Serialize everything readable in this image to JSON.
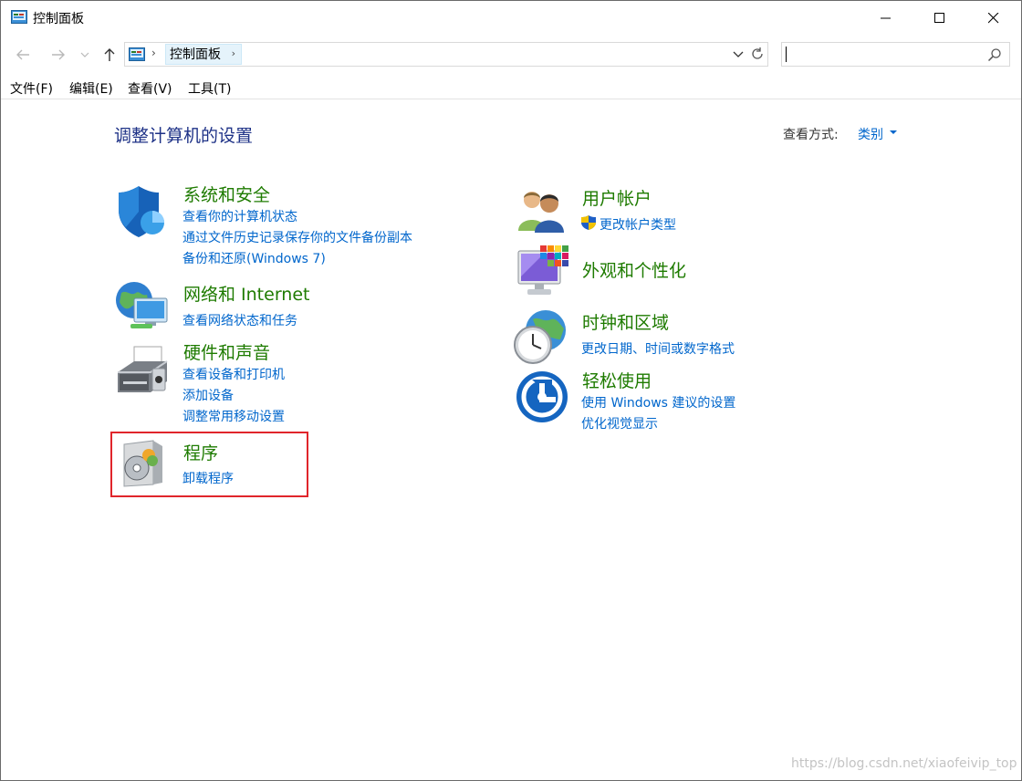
{
  "window": {
    "title": "控制面板"
  },
  "address": {
    "crumb": "控制面板"
  },
  "search": {
    "placeholder": ""
  },
  "menu": [
    "文件(F)",
    "编辑(E)",
    "查看(V)",
    "工具(T)"
  ],
  "content": {
    "heading": "调整计算机的设置",
    "view_by_label": "查看方式:",
    "view_by_value": "类别"
  },
  "categories": {
    "system_security": {
      "title": "系统和安全",
      "links": [
        "查看你的计算机状态",
        "通过文件历史记录保存你的文件备份副本",
        "备份和还原(Windows 7)"
      ]
    },
    "network": {
      "title": "网络和 Internet",
      "links": [
        "查看网络状态和任务"
      ]
    },
    "hardware": {
      "title": "硬件和声音",
      "links": [
        "查看设备和打印机",
        "添加设备",
        "调整常用移动设置"
      ]
    },
    "programs": {
      "title": "程序",
      "links": [
        "卸载程序"
      ]
    },
    "user_accounts": {
      "title": "用户帐户",
      "links": [
        "更改帐户类型"
      ]
    },
    "appearance": {
      "title": "外观和个性化",
      "links": []
    },
    "clock": {
      "title": "时钟和区域",
      "links": [
        "更改日期、时间或数字格式"
      ]
    },
    "ease": {
      "title": "轻松使用",
      "links": [
        "使用 Windows 建议的设置",
        "优化视觉显示"
      ]
    }
  },
  "watermark": "https://blog.csdn.net/xiaofeivip_top",
  "colors": {
    "link": "#0066cc",
    "category_title": "#1e7b00",
    "heading": "#1e3287",
    "highlight": "#e0252b"
  }
}
